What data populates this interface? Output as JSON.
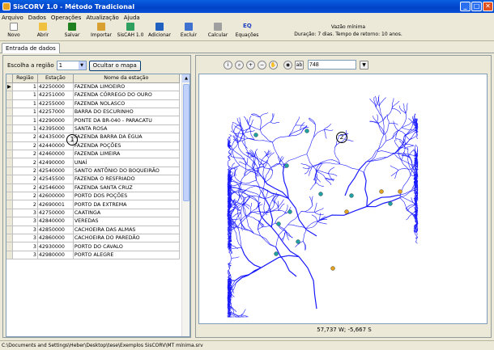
{
  "window": {
    "title": "SisCORV 1.0 - Método Tradicional"
  },
  "menu": [
    "Arquivo",
    "Dados",
    "Operações",
    "Atualização",
    "Ajuda"
  ],
  "toolbar": {
    "novo": "Novo",
    "abrir": "Abrir",
    "salvar": "Salvar",
    "importar": "Importar",
    "siscah": "SisCAH 1.0",
    "adicionar": "Adicionar",
    "excluir": "Excluir",
    "calcular": "Calcular",
    "equacoes": "Equações"
  },
  "status": {
    "line1": "Vazão mínima",
    "line2": "Duração: 7 dias. Tempo de retorno: 10 anos."
  },
  "tab": "Entrada de dados",
  "region": {
    "label": "Escolha a região",
    "value": "1",
    "hide_button": "Ocultar o mapa"
  },
  "table": {
    "headers": [
      "Região",
      "Estação",
      "Nome da estação"
    ],
    "rows": [
      [
        "1",
        "42250000",
        "FAZENDA LIMOEIRO"
      ],
      [
        "1",
        "42251000",
        "FAZENDA CÓRREGO DO OURO"
      ],
      [
        "1",
        "42255000",
        "FAZENDA NOLASCO"
      ],
      [
        "1",
        "42257000",
        "BARRA DO ESCURINHO"
      ],
      [
        "1",
        "42290000",
        "PONTE DA BR-040 - PARACATU"
      ],
      [
        "1",
        "42395000",
        "SANTA ROSA"
      ],
      [
        "2",
        "42435000",
        "FAZENDA BARRA DA ÉGUA"
      ],
      [
        "2",
        "42440000",
        "FAZENDA POÇÕES"
      ],
      [
        "2",
        "42460000",
        "FAZENDA LIMEIRA"
      ],
      [
        "2",
        "42490000",
        "UNAÍ"
      ],
      [
        "2",
        "42540000",
        "SANTO ANTÔNIO DO BOQUEIRÃO"
      ],
      [
        "2",
        "42545500",
        "FAZENDA O RESFRIADO"
      ],
      [
        "2",
        "42546000",
        "FAZENDA SANTA CRUZ"
      ],
      [
        "2",
        "42600000",
        "PORTO DOS POÇÕES"
      ],
      [
        "2",
        "42690001",
        "PORTO DA EXTREMA"
      ],
      [
        "3",
        "42750000",
        "CAATINGA"
      ],
      [
        "3",
        "42840000",
        "VEREDAS"
      ],
      [
        "3",
        "42850000",
        "CACHOEIRA DAS ALMAS"
      ],
      [
        "3",
        "42860000",
        "CACHOEIRA DO PAREDÃO"
      ],
      [
        "3",
        "42930000",
        "PORTO DO CAVALO"
      ],
      [
        "3",
        "42980000",
        "PORTO ALEGRE"
      ]
    ]
  },
  "map": {
    "input_value": "748",
    "coords": "57,737 W; -5,667 S"
  },
  "annotations": {
    "left": "1",
    "right": "2"
  },
  "statusbar": "C:\\Documents and Settings\\Heber\\Desktop\\tese\\Exemplos SisCORV\\MT mínima.srv",
  "colors": {
    "river": "#1a1aff",
    "accent": "#0a5fe0"
  }
}
